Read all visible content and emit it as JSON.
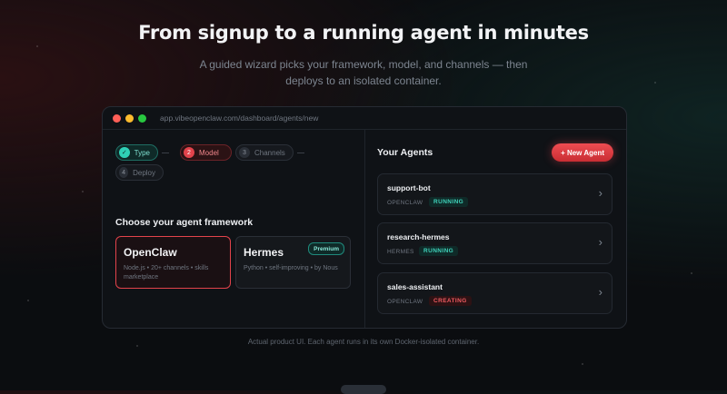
{
  "hero": {
    "title": "From signup to a running agent in minutes",
    "subtitle": "A guided wizard picks your framework, model, and channels — then deploys to an isolated container."
  },
  "window": {
    "url": "app.vibeopenclaw.com/dashboard/agents/new",
    "traffic_light_colors": [
      "#ff5f57",
      "#febc2e",
      "#28c840"
    ]
  },
  "wizard": {
    "steps": [
      {
        "number": "✓",
        "label": "Type",
        "state": "done"
      },
      {
        "number": "2",
        "label": "Model",
        "state": "active"
      },
      {
        "number": "3",
        "label": "Channels",
        "state": "idle"
      },
      {
        "number": "4",
        "label": "Deploy",
        "state": "idle"
      }
    ],
    "section_title": "Choose your agent framework",
    "frameworks": [
      {
        "name": "OpenClaw",
        "description": "Node.js • 20+ channels • skills marketplace",
        "selected": true,
        "badge": ""
      },
      {
        "name": "Hermes",
        "description": "Python • self-improving • by Nous",
        "selected": false,
        "badge": "Premium"
      }
    ]
  },
  "agents_panel": {
    "title": "Your Agents",
    "new_agent_label": "+ New Agent",
    "agents": [
      {
        "name": "support-bot",
        "framework": "OPENCLAW",
        "status": "RUNNING"
      },
      {
        "name": "research-hermes",
        "framework": "HERMES",
        "status": "RUNNING"
      },
      {
        "name": "sales-assistant",
        "framework": "OPENCLAW",
        "status": "CREATING"
      }
    ],
    "chevron_icon": "chevron-right-icon"
  },
  "caption": "Actual product UI. Each agent runs in its own Docker-isolated container.",
  "colors": {
    "accent_red": "#e2434b",
    "accent_teal": "#2fd0b6",
    "background": "#0b0d10"
  }
}
